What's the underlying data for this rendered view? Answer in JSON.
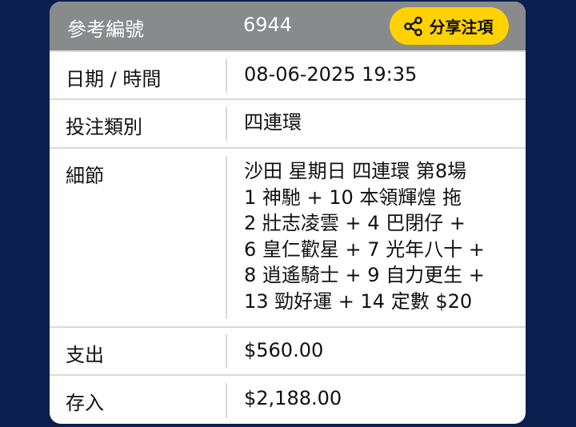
{
  "header": {
    "ref_label": "參考編號",
    "ref_value": "6944",
    "share_label": "分享注項"
  },
  "rows": [
    {
      "key": "日期 / 時間",
      "value": "08-06-2025 19:35"
    },
    {
      "key": "投注類別",
      "value": "四連環"
    },
    {
      "key": "細節",
      "lines": [
        "沙田 星期日 四連環 第8場",
        "1 神馳 + 10 本領輝煌 拖",
        "2 壯志凌雲 + 4 巴閉仔 +",
        "6 皇仁歡星 + 7 光年八十 +",
        "8 逍遙騎士 + 9 自力更生 +",
        "13 勁好運 + 14 定數 $20"
      ]
    },
    {
      "key": "支出",
      "value": "$560.00"
    },
    {
      "key": "存入",
      "value": "$2,188.00"
    }
  ],
  "colors": {
    "background": "#0b1f4f",
    "header": "#888a8c",
    "share_button": "#ffd200"
  },
  "icons": {
    "share": "share-icon"
  }
}
